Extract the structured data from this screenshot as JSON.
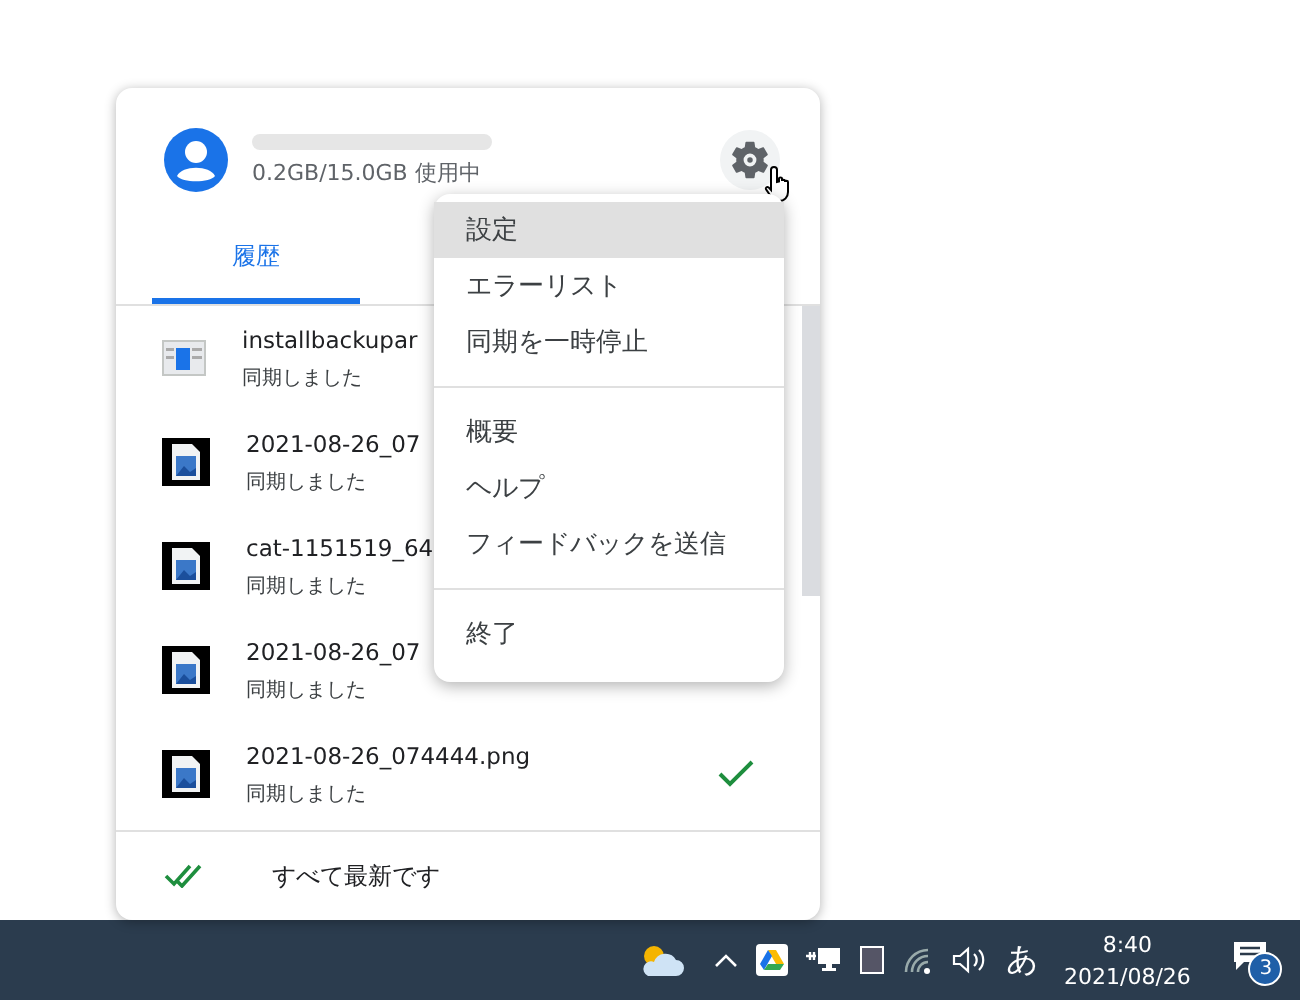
{
  "account": {
    "usage": "0.2GB/15.0GB 使用中"
  },
  "tabs": [
    {
      "label": "履歴",
      "selected": true
    }
  ],
  "files": [
    {
      "name": "installbackupar",
      "status": "同期しました",
      "kind": "app",
      "done": false
    },
    {
      "name": "2021-08-26_07",
      "status": "同期しました",
      "kind": "image",
      "done": false
    },
    {
      "name": "cat-1151519_64",
      "status": "同期しました",
      "kind": "image",
      "done": false
    },
    {
      "name": "2021-08-26_07",
      "status": "同期しました",
      "kind": "image",
      "done": false
    },
    {
      "name": "2021-08-26_074444.png",
      "status": "同期しました",
      "kind": "image",
      "done": true
    }
  ],
  "footer": {
    "text": "すべて最新です"
  },
  "menu": {
    "groups": [
      [
        {
          "label": "設定",
          "selected": true
        },
        {
          "label": "エラーリスト",
          "selected": false
        },
        {
          "label": "同期を一時停止",
          "selected": false
        }
      ],
      [
        {
          "label": "概要",
          "selected": false
        },
        {
          "label": "ヘルプ",
          "selected": false
        },
        {
          "label": "フィードバックを送信",
          "selected": false
        }
      ],
      [
        {
          "label": "終了",
          "selected": false
        }
      ]
    ]
  },
  "taskbar": {
    "ime": "あ",
    "time": "8:40",
    "date": "2021/08/26",
    "notifications": "3"
  }
}
